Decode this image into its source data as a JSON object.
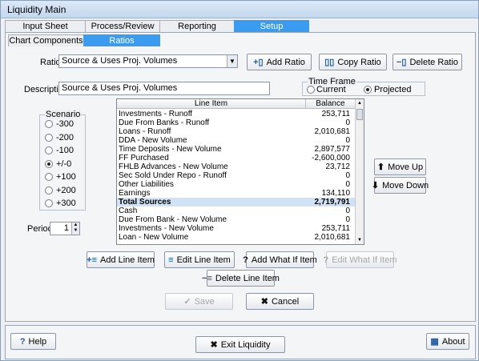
{
  "window": {
    "title": "Liquidity Main"
  },
  "main_tabs": [
    {
      "label": "Input Sheet"
    },
    {
      "label": "Process/Review"
    },
    {
      "label": "Reporting"
    },
    {
      "label": "Setup"
    }
  ],
  "sub_tabs": [
    {
      "label": "Chart Components"
    },
    {
      "label": "Ratios"
    }
  ],
  "ratio": {
    "label": "Ratio",
    "value": "Source & Uses Proj. Volumes"
  },
  "ratio_buttons": {
    "add": "Add Ratio",
    "copy": "Copy Ratio",
    "delete": "Delete Ratio"
  },
  "description": {
    "label": "Description",
    "value": "Source & Uses Proj. Volumes"
  },
  "time_frame": {
    "label": "Time Frame",
    "options": [
      "Current",
      "Projected"
    ],
    "selected": "Projected"
  },
  "scenario": {
    "label": "Scenario",
    "options": [
      "-300",
      "-200",
      "-100",
      "+/-0",
      "+100",
      "+200",
      "+300"
    ],
    "selected": "+/-0"
  },
  "period": {
    "label": "Period",
    "value": "1"
  },
  "grid": {
    "headers": [
      "Line Item",
      "Balance"
    ],
    "rows": [
      {
        "item": "Investments - Runoff",
        "balance": "253,711"
      },
      {
        "item": "Due From Banks - Runoff",
        "balance": "0"
      },
      {
        "item": "Loans - Runoff",
        "balance": "2,010,681"
      },
      {
        "item": "DDA - New Volume",
        "balance": "0"
      },
      {
        "item": "Time Deposits - New Volume",
        "balance": "2,897,577"
      },
      {
        "item": "FF Purchased",
        "balance": "-2,600,000"
      },
      {
        "item": "FHLB Advances - New Volume",
        "balance": "23,712"
      },
      {
        "item": "Sec Sold Under Repo - Runoff",
        "balance": "0"
      },
      {
        "item": "Other Liabilities",
        "balance": "0"
      },
      {
        "item": "Earnings",
        "balance": "134,110"
      },
      {
        "item": "Total Sources",
        "balance": "2,719,791"
      },
      {
        "item": "Cash",
        "balance": "0"
      },
      {
        "item": "Due From Bank - New Volume",
        "balance": "0"
      },
      {
        "item": "Investments - New Volume",
        "balance": "253,711"
      },
      {
        "item": "Loan - New Volume",
        "balance": "2,010,681"
      }
    ]
  },
  "move_buttons": {
    "up": "Move Up",
    "down": "Move Down"
  },
  "line_buttons": {
    "add": "Add Line Item",
    "edit": "Edit Line Item",
    "add_what_if": "Add What If Item",
    "edit_what_if": "Edit What If Item",
    "delete": "Delete Line Item"
  },
  "action_buttons": {
    "save": "Save",
    "cancel": "Cancel"
  },
  "footer": {
    "help": "Help",
    "exit": "Exit Liquidity",
    "about": "About"
  },
  "colors": {
    "active_tab": "#3a9cf1",
    "highlight_row": "#cfe2f6"
  }
}
